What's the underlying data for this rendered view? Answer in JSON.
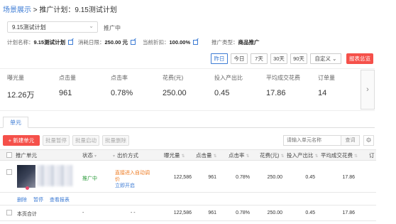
{
  "breadcrumb": {
    "root": "场景展示",
    "separator": ">",
    "current": "推广计划：9.15测试计划"
  },
  "plan_select": {
    "value": "9.15测试计划",
    "status": "推广中"
  },
  "plan_info": {
    "name_label": "计划名称：",
    "name_value": "9.15测试计划",
    "budget_label": "消耗日限：",
    "budget_value": "250.00 元",
    "discount_label": "当前折扣：",
    "discount_value": "100.00%",
    "type_label": "推广类型：",
    "type_value": "商品推广"
  },
  "date_filters": [
    "昨日",
    "今日",
    "7天",
    "30天",
    "90天",
    "自定义"
  ],
  "date_active": "昨日",
  "report_button": "报表总览",
  "metrics": [
    {
      "label": "曝光量",
      "value": "12.26万"
    },
    {
      "label": "点击量",
      "value": "961"
    },
    {
      "label": "点击率",
      "value": "0.78%"
    },
    {
      "label": "花费(元)",
      "value": "250.00"
    },
    {
      "label": "投入产出比",
      "value": "0.45"
    },
    {
      "label": "平均成交花费",
      "value": "17.86"
    },
    {
      "label": "订单量",
      "value": "14"
    }
  ],
  "tab": "单元",
  "toolbar": {
    "new_unit": "+ 新建单元",
    "bulk_pause": "批量暂停",
    "bulk_start": "批量启动",
    "bulk_delete": "批量删除",
    "search_placeholder": "请输入单元名称",
    "search_button": "查词"
  },
  "table": {
    "columns": [
      "推广单元",
      "状态",
      "出价方式",
      "曝光量",
      "点击量",
      "点击率",
      "花费(元)",
      "投入产出比",
      "平均成交花费",
      "订"
    ],
    "row": {
      "status": "推广中",
      "bid_line1": "直接进入自动调",
      "bid_line2": "价",
      "bid_line3": "立即开启",
      "impressions": "122,586",
      "clicks": "961",
      "ctr": "0.78%",
      "cost": "250.00",
      "roi": "0.45",
      "avg_cost": "17.86",
      "actions": [
        "删除",
        "暂停",
        "查看报表"
      ]
    },
    "summary": {
      "label": "本页合计",
      "status": "-",
      "bid": "- -",
      "impressions": "122,586",
      "clicks": "961",
      "ctr": "0.78%",
      "cost": "250.00",
      "roi": "0.45",
      "avg_cost": "17.86"
    }
  },
  "colors": {
    "accent": "#3c7bd4",
    "danger": "#f5504a",
    "success": "#2a9b3a",
    "warning": "#ee7a20"
  }
}
